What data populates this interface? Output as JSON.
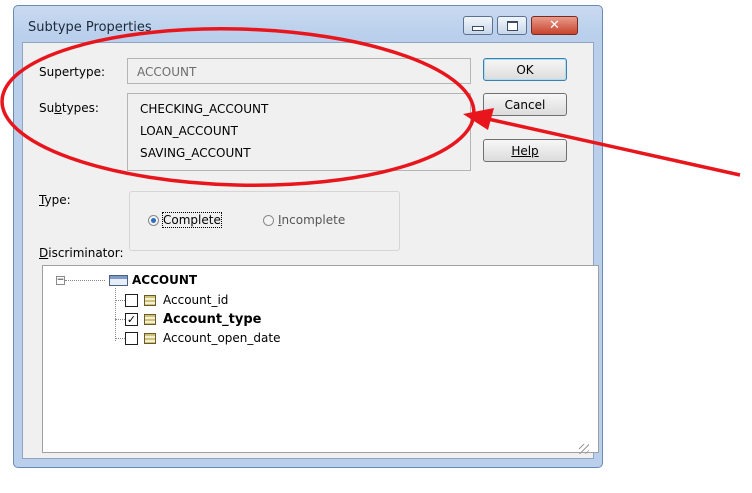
{
  "window": {
    "title": "Subtype Properties",
    "close_glyph": "✕"
  },
  "form": {
    "supertype_label_pre": "Supertype:",
    "supertype_value": "ACCOUNT",
    "subtypes_label_pre": "Su",
    "subtypes_label_key": "b",
    "subtypes_label_post": "types:",
    "subtypes": [
      "CHECKING_ACCOUNT",
      "LOAN_ACCOUNT",
      "SAVING_ACCOUNT"
    ],
    "type_label_key": "T",
    "type_label_post": "ype:",
    "discriminator_label_key": "D",
    "discriminator_label_post": "iscriminator:"
  },
  "buttons": {
    "ok": "OK",
    "cancel": "Cancel",
    "help": "Help"
  },
  "type_options": {
    "complete": "Complete",
    "incomplete_key": "I",
    "incomplete_post": "ncomplete",
    "selected": "Complete"
  },
  "tree": {
    "root": "ACCOUNT",
    "expander_glyph": "−",
    "columns": [
      {
        "name": "Account_id",
        "checked": false
      },
      {
        "name": "Account_type",
        "checked": true
      },
      {
        "name": "Account_open_date",
        "checked": false
      }
    ],
    "check_glyph": "✓"
  },
  "colors": {
    "annotation": "#e8161c",
    "dialog_frame": "#b9cfec",
    "radio_selected": "#2a6fbd"
  }
}
